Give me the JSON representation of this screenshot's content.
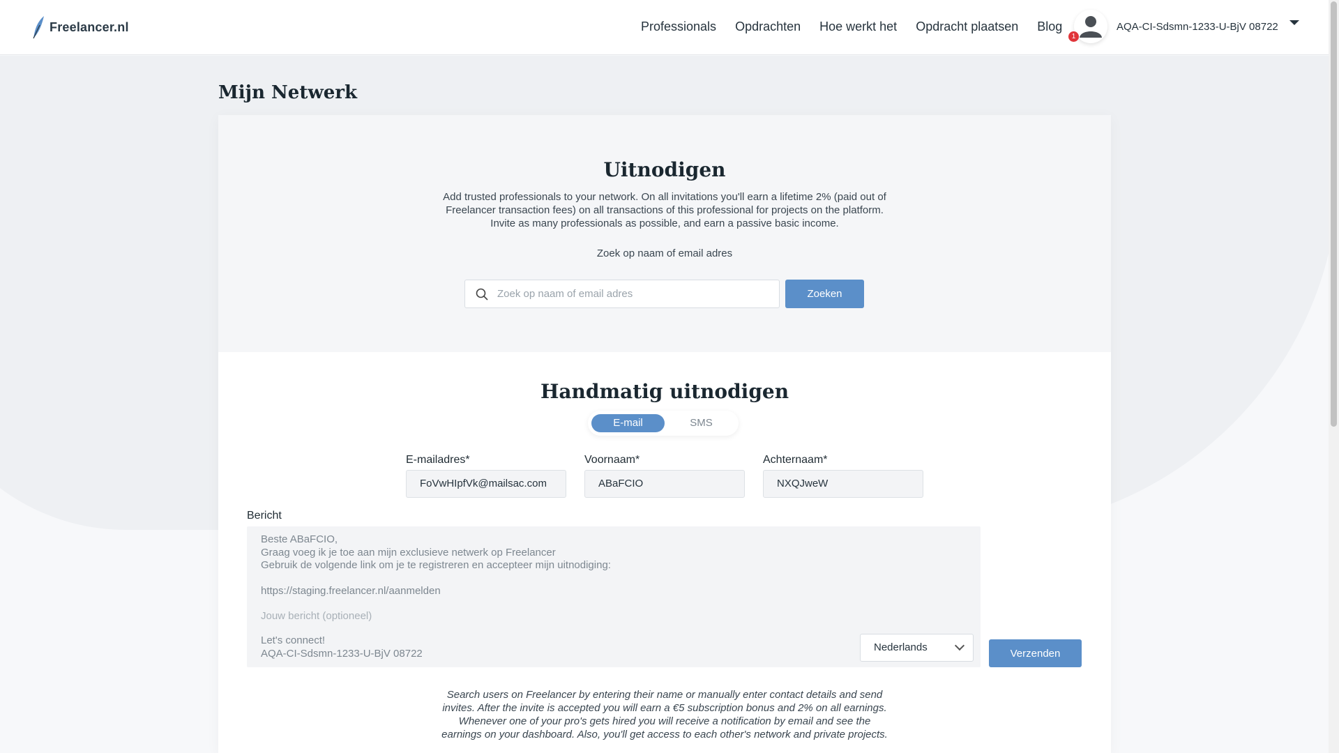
{
  "header": {
    "logo_text": "Freelancer.nl",
    "nav": [
      "Professionals",
      "Opdrachten",
      "Hoe werkt het",
      "Opdracht plaatsen",
      "Blog"
    ],
    "notification_count": "1",
    "user_name": "AQA-CI-Sdsmn-1233-U-BjV 08722"
  },
  "page": {
    "title": "Mijn Netwerk"
  },
  "invite": {
    "title": "Uitnodigen",
    "intro": "Add trusted professionals to your network. On all invitations you'll earn a lifetime 2% (paid out of Freelancer transaction fees) on all transactions of this professional for projects on the platform. Invite as many professionals as possible, and earn a passive basic income.",
    "search_label": "Zoek op naam of email adres",
    "search_placeholder": "Zoek op naam of email adres",
    "search_button": "Zoeken"
  },
  "manual": {
    "title": "Handmatig uitnodigen",
    "tabs": [
      "E-mail",
      "SMS"
    ],
    "active_tab": "E-mail",
    "email_label": "E-mailadres*",
    "email_value": "FoVwHIpfVk@mailsac.com",
    "firstname_label": "Voornaam*",
    "firstname_value": "ABaFCIO",
    "lastname_label": "Achternaam*",
    "lastname_value": "NXQJweW",
    "message_label": "Bericht",
    "message_lines": [
      "Beste ABaFCIO,",
      "Graag voeg ik je toe aan mijn exclusieve netwerk op Freelancer",
      "Gebruik de volgende link om je te registreren en accepteer mijn uitnodiging:",
      "",
      "https://staging.freelancer.nl/aanmelden"
    ],
    "message_placeholder": "Jouw bericht (optioneel)",
    "message_closing": [
      "Let's connect!",
      "AQA-CI-Sdsmn-1233-U-BjV 08722"
    ],
    "language": "Nederlands",
    "send_button": "Verzenden",
    "footnote": "Search users on Freelancer by entering their name or manually enter contact details and send invites. After the invite is accepted you will earn a €5 subscription bonus and 2% on all earnings. Whenever one of your pro's gets hired you will receive a notification by email and see the earnings on your dashboard. Also, you'll get access to each other's network and private projects."
  },
  "colors": {
    "accent": "#5b8fc9",
    "badge": "#e0353a"
  }
}
